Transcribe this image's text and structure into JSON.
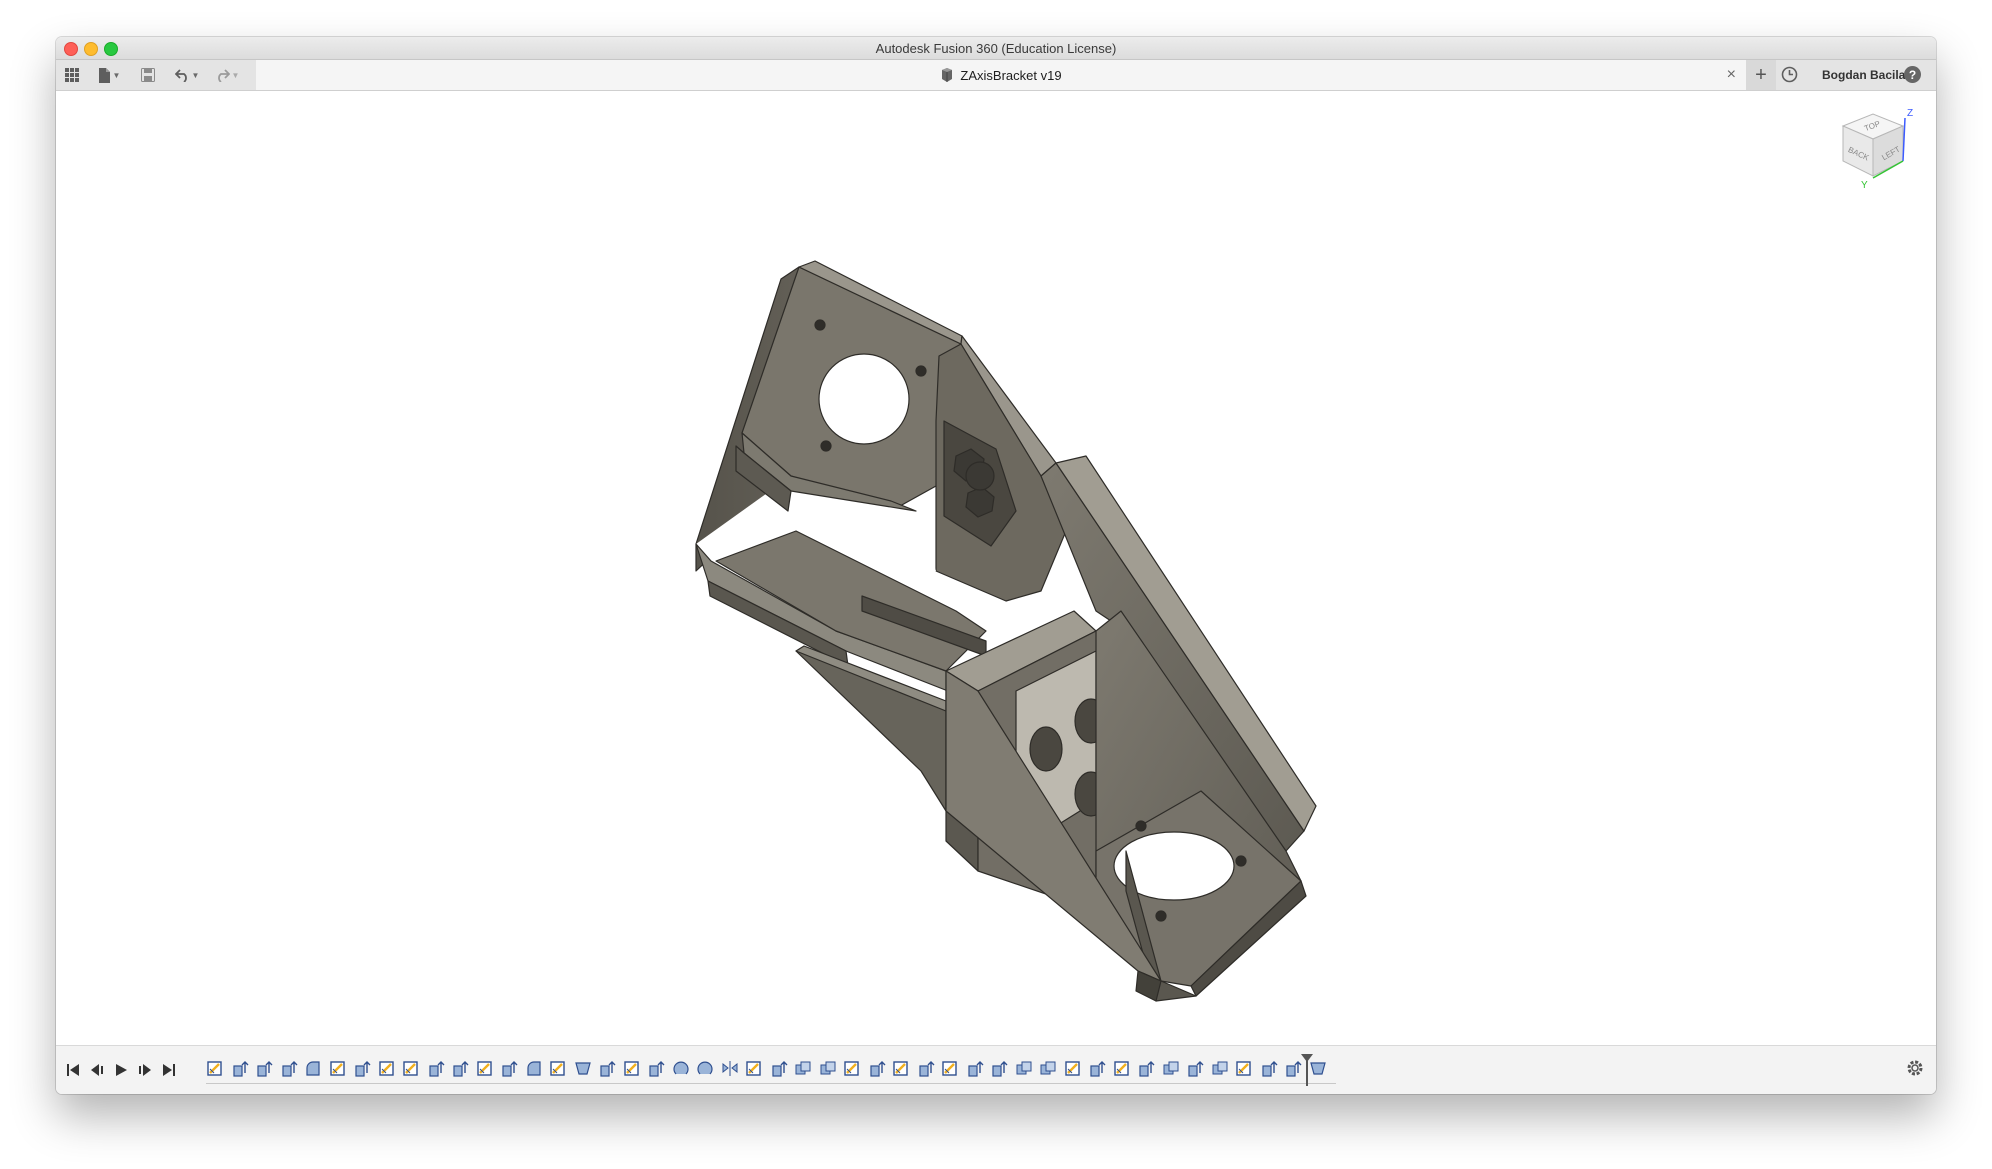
{
  "window": {
    "title": "Autodesk Fusion 360 (Education License)"
  },
  "toolbar": {
    "grid_icon": "data-panel-grid-icon",
    "file_icon": "file-icon",
    "save_icon": "save-icon",
    "undo_icon": "undo-icon",
    "redo_icon": "redo-icon"
  },
  "document_tab": {
    "title": "ZAxisBracket v19",
    "close": "×"
  },
  "new_tab": "+",
  "user": {
    "name": "Bogdan Bacila"
  },
  "help": "?",
  "viewcube": {
    "top": "TOP",
    "back": "BACK",
    "left": "LEFT",
    "axis_z": "Z",
    "axis_y": "Y"
  },
  "timeline": {
    "controls": [
      "first-frame",
      "previous-frame",
      "play",
      "next-frame",
      "last-frame"
    ],
    "feature_types": [
      "sketch",
      "extrude",
      "extrude",
      "extrude",
      "fillet",
      "sketch",
      "extrude",
      "sketch",
      "sketch",
      "extrude",
      "extrude",
      "sketch",
      "extrude",
      "fillet",
      "sketch",
      "chamfer",
      "extrude",
      "sketch",
      "extrude",
      "revolve",
      "revolve",
      "mirror",
      "sketch",
      "extrude",
      "combine",
      "combine",
      "sketch",
      "extrude",
      "sketch",
      "extrude",
      "sketch",
      "extrude",
      "extrude",
      "combine",
      "combine",
      "sketch",
      "extrude",
      "sketch",
      "extrude",
      "combine",
      "extrude",
      "combine",
      "sketch",
      "extrude",
      "extrude",
      "chamfer"
    ],
    "settings_icon": "gear-icon"
  },
  "colors": {
    "accent_sketch": "#f2b01e",
    "body": "#6f6c63",
    "axis_z": "#3c5bff",
    "axis_y": "#33c433"
  }
}
